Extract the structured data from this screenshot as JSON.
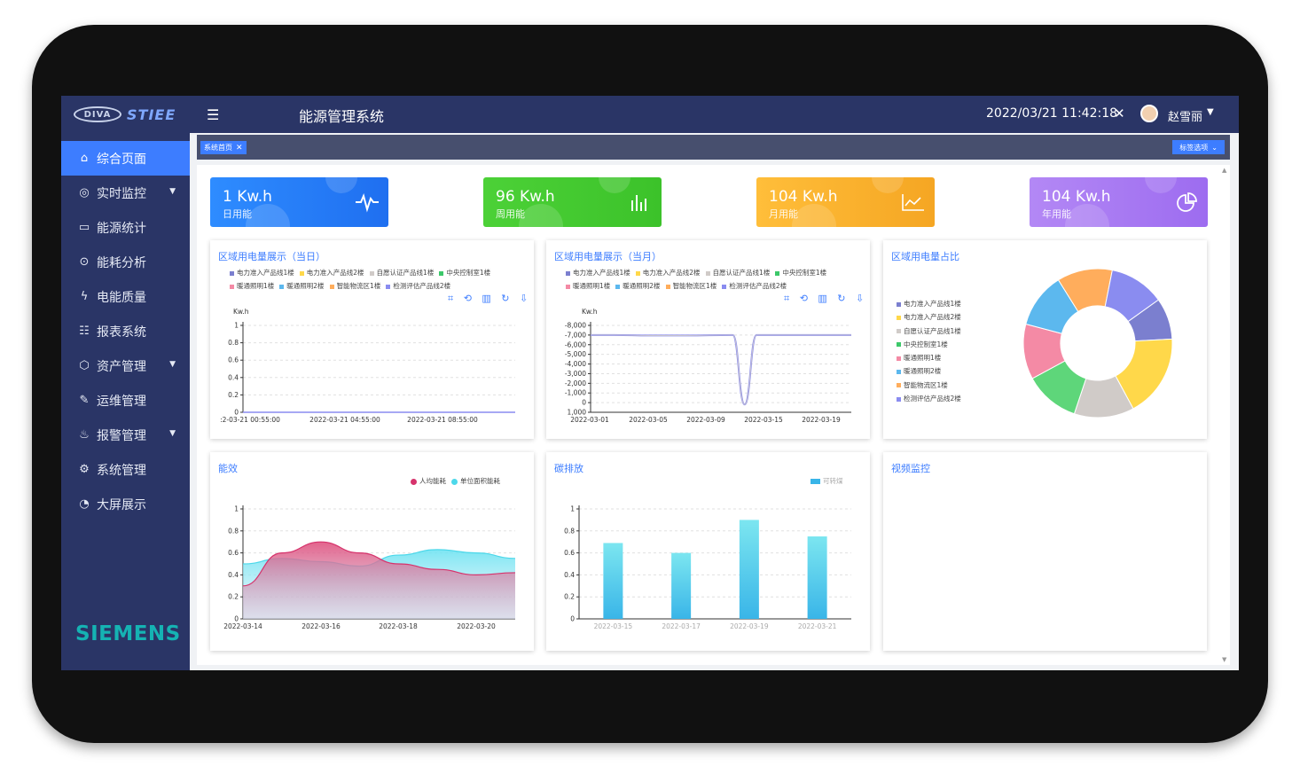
{
  "header": {
    "logo_badge": "DIVA",
    "logo_text": "STIEE",
    "title": "能源管理系统",
    "datetime": "2022/03/21 11:42:18",
    "username": "赵雪丽"
  },
  "sidebar": {
    "items": [
      {
        "label": "综合页面",
        "icon": "home-icon",
        "active": true
      },
      {
        "label": "实时监控",
        "icon": "monitor-icon",
        "caret": true
      },
      {
        "label": "能源统计",
        "icon": "stats-icon"
      },
      {
        "label": "能耗分析",
        "icon": "analysis-icon"
      },
      {
        "label": "电能质量",
        "icon": "bolt-icon"
      },
      {
        "label": "报表系统",
        "icon": "report-icon"
      },
      {
        "label": "资产管理",
        "icon": "cube-icon",
        "caret": true
      },
      {
        "label": "运维管理",
        "icon": "wrench-icon"
      },
      {
        "label": "报警管理",
        "icon": "alarm-icon",
        "caret": true
      },
      {
        "label": "系统管理",
        "icon": "gear-icon"
      },
      {
        "label": "大屏展示",
        "icon": "pie-icon"
      }
    ],
    "brand": "SIEMENS"
  },
  "tagbar": {
    "tag_label": "系统首页",
    "options_label": "标签选项"
  },
  "stats": [
    {
      "value": "1 Kw.h",
      "label": "日用能",
      "color_from": "#2e8cff",
      "color_to": "#1f6ff0",
      "icon": "pulse-icon"
    },
    {
      "value": "96 Kw.h",
      "label": "周用能",
      "color_from": "#4cd137",
      "color_to": "#3cc22a",
      "icon": "bar-chart-icon"
    },
    {
      "value": "104 Kw.h",
      "label": "月用能",
      "color_from": "#ffbe3a",
      "color_to": "#f5a623",
      "icon": "line-chart-icon"
    },
    {
      "value": "104 Kw.h",
      "label": "年用能",
      "color_from": "#b388f5",
      "color_to": "#9d6cf0",
      "icon": "pie-chart-icon"
    }
  ],
  "series_names": [
    "电力准入产品线1楼",
    "电力准入产品线2楼",
    "自愿认证产品线1楼",
    "中央控制室1楼",
    "暖通照明1楼",
    "暖通照明2楼",
    "智能物流区1楼",
    "检测评估产品线2楼"
  ],
  "series_colors": [
    "#7b7fcf",
    "#ffd84a",
    "#d0cbc8",
    "#3cc86a",
    "#f48aa5",
    "#5cb8ee",
    "#ffad5c",
    "#8a8cf0"
  ],
  "chart_data": [
    {
      "type": "line",
      "title": "区域用电量展示（当日）",
      "ylabel": "Kw.h",
      "ylim": [
        0,
        1
      ],
      "yticks": [
        "0",
        "0.2",
        "0.4",
        "0.6",
        "0.8",
        "1"
      ],
      "xticks": [
        ":2-03-21 00:55:00",
        "2022-03-21 04:55:00",
        "2022-03-21 08:55:00"
      ],
      "legend_series": [
        "电力准入产品线1楼",
        "电力准入产品线2楼",
        "自愿认证产品线1楼",
        "中央控制室1楼",
        "暖通照明1楼",
        "暖通照明2楼",
        "智能物流区1楼",
        "检测评估产品线2楼"
      ],
      "toolbox": "⌗ ⟲ ▥ ↻ ⇩"
    },
    {
      "type": "line",
      "title": "区域用电量展示（当月）",
      "ylabel": "Kw.h",
      "ylim": [
        -8000,
        1000
      ],
      "yticks": [
        "1,000",
        "0",
        "-1,000",
        "-2,000",
        "-3,000",
        "-4,000",
        "-5,000",
        "-6,000",
        "-7,000",
        "-8,000"
      ],
      "xticks": [
        "2022-03-01",
        "2022-03-05",
        "2022-03-09",
        "2022-03-15",
        "2022-03-19"
      ],
      "legend_series": [
        "电力准入产品线1楼",
        "电力准入产品线2楼",
        "自愿认证产品线1楼",
        "中央控制室1楼",
        "暖通照明1楼",
        "暖通照明2楼",
        "智能物流区1楼",
        "检测评估产品线2楼"
      ],
      "toolbox": "⌗ ⟲ ▥ ↻ ⇩",
      "series": [
        {
          "name": "检测评估产品线2楼",
          "values": [
            {
              "x": 0,
              "y": 0
            },
            {
              "x": 2,
              "y": 0
            },
            {
              "x": 5,
              "y": -50
            },
            {
              "x": 8,
              "y": -50
            },
            {
              "x": 12,
              "y": 0
            },
            {
              "x": 13,
              "y": -7200
            },
            {
              "x": 14,
              "y": 0
            },
            {
              "x": 16,
              "y": 0
            },
            {
              "x": 20,
              "y": 0
            },
            {
              "x": 22,
              "y": 0
            }
          ]
        }
      ]
    },
    {
      "type": "pie",
      "title": "区域用电量占比",
      "legend_series": [
        "电力准入产品线1楼",
        "电力准入产品线2楼",
        "自愿认证产品线1楼",
        "中央控制室1楼",
        "暖通照明1楼",
        "暖通照明2楼",
        "智能物流区1楼",
        "检测评估产品线2楼"
      ],
      "slices": [
        {
          "name": "电力准入产品线1楼",
          "value": 9
        },
        {
          "name": "电力准入产品线2楼",
          "value": 18
        },
        {
          "name": "自愿认证产品线1楼",
          "value": 13
        },
        {
          "name": "中央控制室1楼",
          "value": 12
        },
        {
          "name": "暖通照明1楼",
          "value": 12
        },
        {
          "name": "暖通照明2楼",
          "value": 12
        },
        {
          "name": "智能物流区1楼",
          "value": 12
        },
        {
          "name": "检测评估产品线2楼",
          "value": 12
        }
      ]
    },
    {
      "type": "area",
      "title": "能效",
      "ylim": [
        0,
        1
      ],
      "yticks": [
        "0",
        "0.2",
        "0.4",
        "0.6",
        "0.8",
        "1"
      ],
      "xticks": [
        "2022-03-14",
        "2022-03-16",
        "2022-03-18",
        "2022-03-20"
      ],
      "series": [
        {
          "name": "人均能耗",
          "color": "#d6336c",
          "values": [
            0.3,
            0.6,
            0.7,
            0.6,
            0.5,
            0.45,
            0.4,
            0.42
          ]
        },
        {
          "name": "单位面积能耗",
          "color": "#4dd8ea",
          "values": [
            0.5,
            0.55,
            0.52,
            0.48,
            0.58,
            0.63,
            0.6,
            0.55
          ]
        }
      ]
    },
    {
      "type": "bar",
      "title": "碳排放",
      "ylim": [
        0,
        1
      ],
      "yticks": [
        "0",
        "0.2",
        "0.4",
        "0.6",
        "0.8",
        "1"
      ],
      "categories": [
        "2022-03-15",
        "2022-03-17",
        "2022-03-19",
        "2022-03-21"
      ],
      "series": [
        {
          "name": "可转煤",
          "color": "#39b5e8",
          "values": [
            0.69,
            0.6,
            0.9,
            0.75
          ]
        }
      ]
    }
  ],
  "video_panel": {
    "title": "视频监控"
  }
}
